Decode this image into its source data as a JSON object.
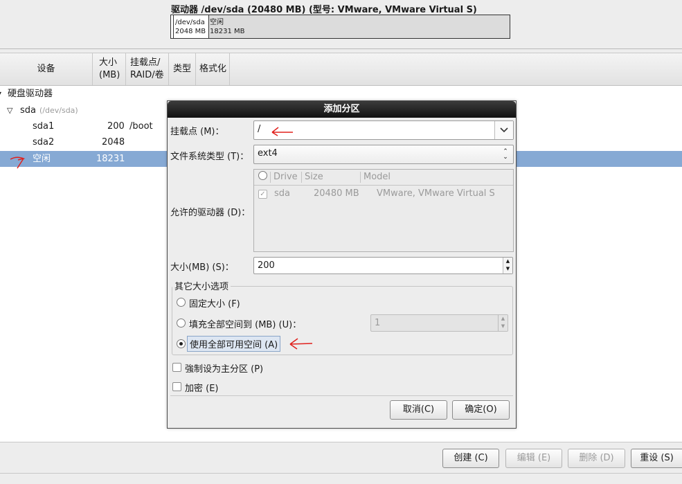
{
  "drive": {
    "title": "驱动器 /dev/sda (20480 MB) (型号: VMware, VMware Virtual S)",
    "sda2_path": "/dev/sda",
    "sda2_size": "2048 MB",
    "free_label": "空闲",
    "free_size": "18231 MB"
  },
  "tree": {
    "columns": [
      "设备",
      "大小\n(MB)",
      "挂载点/\nRAID/卷",
      "类型",
      "格式化"
    ],
    "root_label": "硬盘驱动器",
    "disk_name": "sda",
    "disk_path": "(/dev/sda)",
    "rows": [
      {
        "device": "sda1",
        "size": "200",
        "mount": "/boot"
      },
      {
        "device": "sda2",
        "size": "2048",
        "mount": ""
      },
      {
        "device": "空闲",
        "size": "18231",
        "mount": ""
      }
    ]
  },
  "dialog": {
    "title": "添加分区",
    "mount_label": "挂载点 (M)：",
    "mount_value": "/",
    "fs_label": "文件系统类型 (T)：",
    "fs_value": "ext4",
    "drives_label": "允许的驱动器 (D)：",
    "drives_headers": [
      "Drive",
      "Size",
      "Model"
    ],
    "drives_rows": [
      {
        "checked": true,
        "drive": "sda",
        "size": "20480 MB",
        "model": "VMware, VMware Virtual S"
      }
    ],
    "size_label": "大小(MB) (S)：",
    "size_value": "200",
    "other_size_title": "其它大小选项",
    "opt_fixed": "固定大小 (F)",
    "opt_fill_upto": "填充全部空间到 (MB) (U)：",
    "fill_upto_value": "1",
    "opt_fill_all": "使用全部可用空间 (A)",
    "selected_option": "fill_all",
    "force_primary": "強制设为主分区 (P)",
    "encrypt": "加密 (E)",
    "cancel": "取消(C)",
    "ok": "确定(O)"
  },
  "bottom_buttons": {
    "create": "创建 (C)",
    "edit": "编辑 (E)",
    "delete": "删除 (D)",
    "reset": "重设 (S)"
  },
  "colors": {
    "selection": "#86a9d4",
    "annotation": "#e0201c"
  }
}
